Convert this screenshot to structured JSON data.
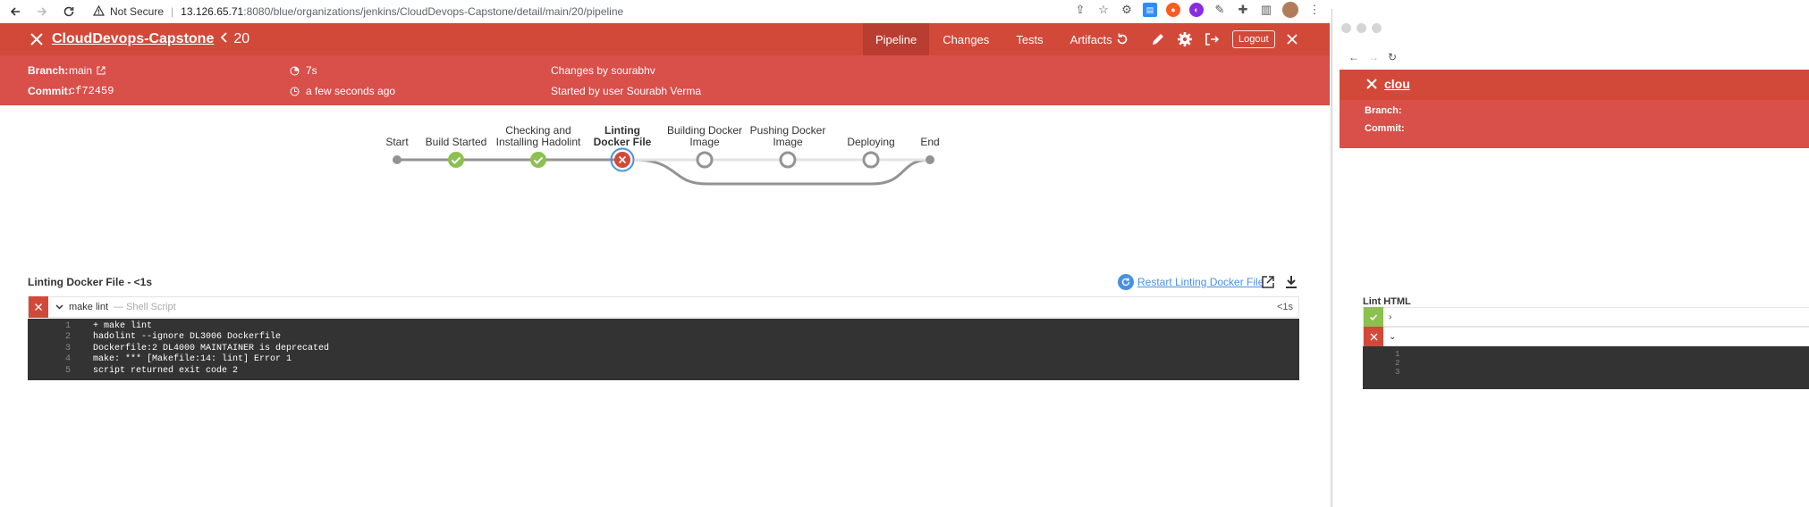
{
  "browser": {
    "security_label": "Not Secure",
    "url_host": "13.126.65.71",
    "url_path": ":8080/blue/organizations/jenkins/CloudDevops-Capstone/detail/main/20/pipeline"
  },
  "header": {
    "job_name": "CloudDevops-Capstone",
    "run_number": "20",
    "tabs": [
      {
        "label": "Pipeline",
        "active": true
      },
      {
        "label": "Changes",
        "active": false
      },
      {
        "label": "Tests",
        "active": false
      },
      {
        "label": "Artifacts",
        "active": false
      }
    ],
    "logout_label": "Logout"
  },
  "meta": {
    "branch_label": "Branch:",
    "branch_value": "main",
    "commit_label": "Commit:",
    "commit_value": "cf72459",
    "duration": "7s",
    "started_ago": "a few seconds ago",
    "changes_by": "Changes by sourabhv",
    "started_by": "Started by user Sourabh Verma"
  },
  "pipeline": {
    "stages": [
      {
        "name": "Start",
        "status": "start"
      },
      {
        "name": "Build Started",
        "status": "success"
      },
      {
        "name": "Checking and Installing Hadolint",
        "status": "success"
      },
      {
        "name": "Linting Docker File",
        "status": "failed"
      },
      {
        "name": "Building Docker Image",
        "status": "not_built"
      },
      {
        "name": "Pushing Docker Image",
        "status": "not_built"
      },
      {
        "name": "Deploying",
        "status": "not_built"
      },
      {
        "name": "End",
        "status": "end"
      }
    ]
  },
  "step_panel": {
    "title": "Linting Docker File - <1s",
    "restart_label": "Restart Linting Docker File",
    "step": {
      "name": "make lint",
      "type": "— Shell Script",
      "duration": "<1s"
    },
    "log": [
      {
        "n": "1",
        "text": "+ make lint"
      },
      {
        "n": "2",
        "text": "hadolint --ignore DL3006 Dockerfile"
      },
      {
        "n": "3",
        "text": "Dockerfile:2 DL4000 MAINTAINER is deprecated"
      },
      {
        "n": "4",
        "text": "make: *** [Makefile:14: lint] Error 1"
      },
      {
        "n": "5",
        "text": "script returned exit code 2"
      }
    ]
  },
  "popup": {
    "title_fragment": "clou",
    "branch_label": "Branch:",
    "commit_label": "Commit:",
    "panel_fragment": "Lint HTML",
    "log_nums": [
      "1",
      "2",
      "3"
    ]
  },
  "colors": {
    "header_red": "#d24939",
    "meta_red": "#d94f4a",
    "success_green": "#8cc04f",
    "failed_red": "#d24939",
    "link_blue": "#4a90e2"
  }
}
